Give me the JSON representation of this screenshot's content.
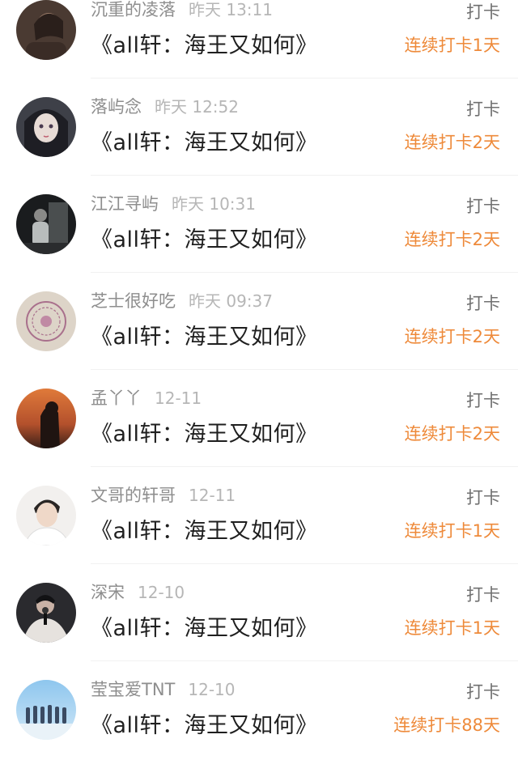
{
  "checkins": [
    {
      "name": "沉重的凌落",
      "time": "昨天 13:11",
      "title": "《all轩：海王又如何》",
      "action": "打卡",
      "streak": "连续打卡1天",
      "avatar": "dark-portrait-avatar"
    },
    {
      "name": "落屿念",
      "time": "昨天 12:52",
      "title": "《all轩：海王又如何》",
      "action": "打卡",
      "streak": "连续打卡2天",
      "avatar": "anime-girl-avatar"
    },
    {
      "name": "江江寻屿",
      "time": "昨天 10:31",
      "title": "《all轩：海王又如何》",
      "action": "打卡",
      "streak": "连续打卡2天",
      "avatar": "night-scene-avatar"
    },
    {
      "name": "芝士很好吃",
      "time": "昨天 09:37",
      "title": "《all轩：海王又如何》",
      "action": "打卡",
      "streak": "连续打卡2天",
      "avatar": "badge-logo-avatar"
    },
    {
      "name": "孟丫丫",
      "time": "12-11",
      "title": "《all轩：海王又如何》",
      "action": "打卡",
      "streak": "连续打卡2天",
      "avatar": "sunset-silhouette-avatar"
    },
    {
      "name": "文哥的轩哥",
      "time": "12-11",
      "title": "《all轩：海王又如何》",
      "action": "打卡",
      "streak": "连续打卡1天",
      "avatar": "young-man-portrait-avatar"
    },
    {
      "name": "深宋",
      "time": "12-10",
      "title": "《all轩：海王又如何》",
      "action": "打卡",
      "streak": "连续打卡1天",
      "avatar": "singer-microphone-avatar"
    },
    {
      "name": "莹宝爱TNT",
      "time": "12-10",
      "title": "《all轩：海王又如何》",
      "action": "打卡",
      "streak": "连续打卡88天",
      "avatar": "group-photo-avatar"
    }
  ]
}
